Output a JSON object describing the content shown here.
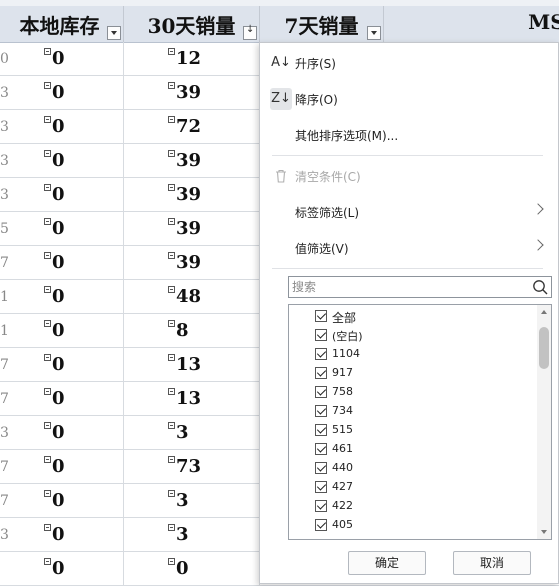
{
  "headers": [
    {
      "label": "本地库存",
      "sorted": false
    },
    {
      "label": "30天销量",
      "sorted": true
    },
    {
      "label": "7天销量",
      "sorted": false
    },
    {
      "label": "MSI",
      "sorted": false
    }
  ],
  "rows": [
    {
      "edge": "0",
      "stock": "0",
      "sales30": "12"
    },
    {
      "edge": "3",
      "stock": "0",
      "sales30": "39"
    },
    {
      "edge": "3",
      "stock": "0",
      "sales30": "72"
    },
    {
      "edge": "3",
      "stock": "0",
      "sales30": "39"
    },
    {
      "edge": "3",
      "stock": "0",
      "sales30": "39"
    },
    {
      "edge": "5",
      "stock": "0",
      "sales30": "39"
    },
    {
      "edge": "7",
      "stock": "0",
      "sales30": "39"
    },
    {
      "edge": "1",
      "stock": "0",
      "sales30": "48"
    },
    {
      "edge": "1",
      "stock": "0",
      "sales30": "8"
    },
    {
      "edge": "7",
      "stock": "0",
      "sales30": "13"
    },
    {
      "edge": "7",
      "stock": "0",
      "sales30": "13"
    },
    {
      "edge": "3",
      "stock": "0",
      "sales30": "3"
    },
    {
      "edge": "7",
      "stock": "0",
      "sales30": "73"
    },
    {
      "edge": "7",
      "stock": "0",
      "sales30": "3"
    },
    {
      "edge": "3",
      "stock": "0",
      "sales30": "3"
    },
    {
      "edge": "",
      "stock": "0",
      "sales30": "0"
    }
  ],
  "menu": {
    "sort_asc": "升序(S)",
    "sort_desc": "降序(O)",
    "more_sort": "其他排序选项(M)...",
    "clear": "清空条件(C)",
    "label_filter": "标签筛选(L)",
    "value_filter": "值筛选(V)",
    "search_placeholder": "搜索",
    "items": [
      "全部",
      "(空白)",
      "1104",
      "917",
      "758",
      "734",
      "515",
      "461",
      "440",
      "427",
      "422",
      "405"
    ],
    "ok": "确定",
    "cancel": "取消"
  }
}
